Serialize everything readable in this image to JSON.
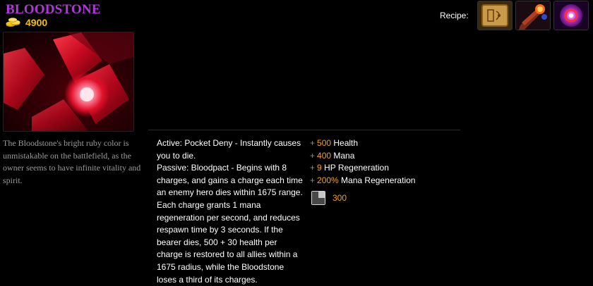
{
  "item": {
    "name": "BLOODSTONE",
    "cost": "4900",
    "image_icon": "bloodstone-red-crystal-icon",
    "lore": "The Bloodstone's bright ruby color is unmistakable on the battlefield, as the owner seems to have infinite vitality and spirit.",
    "active": "Active: Pocket Deny - Instantly causes you to die.",
    "passive": "Passive: Bloodpact - Begins with 8 charges, and gains a charge each time an enemy hero dies within 1675 range. Each charge grants 1 mana regeneration per second, and reduces respawn time by 3 seconds. If the bearer dies, 500 + 30 health per charge is restored to all allies within a 1675 radius, while the Bloodstone loses a third of its charges.",
    "stats": [
      {
        "plus": "+",
        "value": "500",
        "label": " Health"
      },
      {
        "plus": "+",
        "value": "400",
        "label": " Mana"
      },
      {
        "plus": "+",
        "value": "9",
        "label": " HP Regeneration"
      },
      {
        "plus": "+",
        "value": "200%",
        "label": " Mana Regeneration"
      }
    ],
    "cooldown": "300",
    "cooldown_icon": "cooldown-clock-icon",
    "gold_icon": "gold-coins-icon"
  },
  "recipe": {
    "label": "Recipe:",
    "items": [
      {
        "icon": "recipe-scroll-icon"
      },
      {
        "icon": "soul-booster-icon"
      },
      {
        "icon": "soul-ring-icon"
      }
    ]
  },
  "colors": {
    "title": "#b437dd",
    "gold": "#f2c200",
    "stat_value": "#f0a020",
    "lore": "#9a9a9a"
  }
}
